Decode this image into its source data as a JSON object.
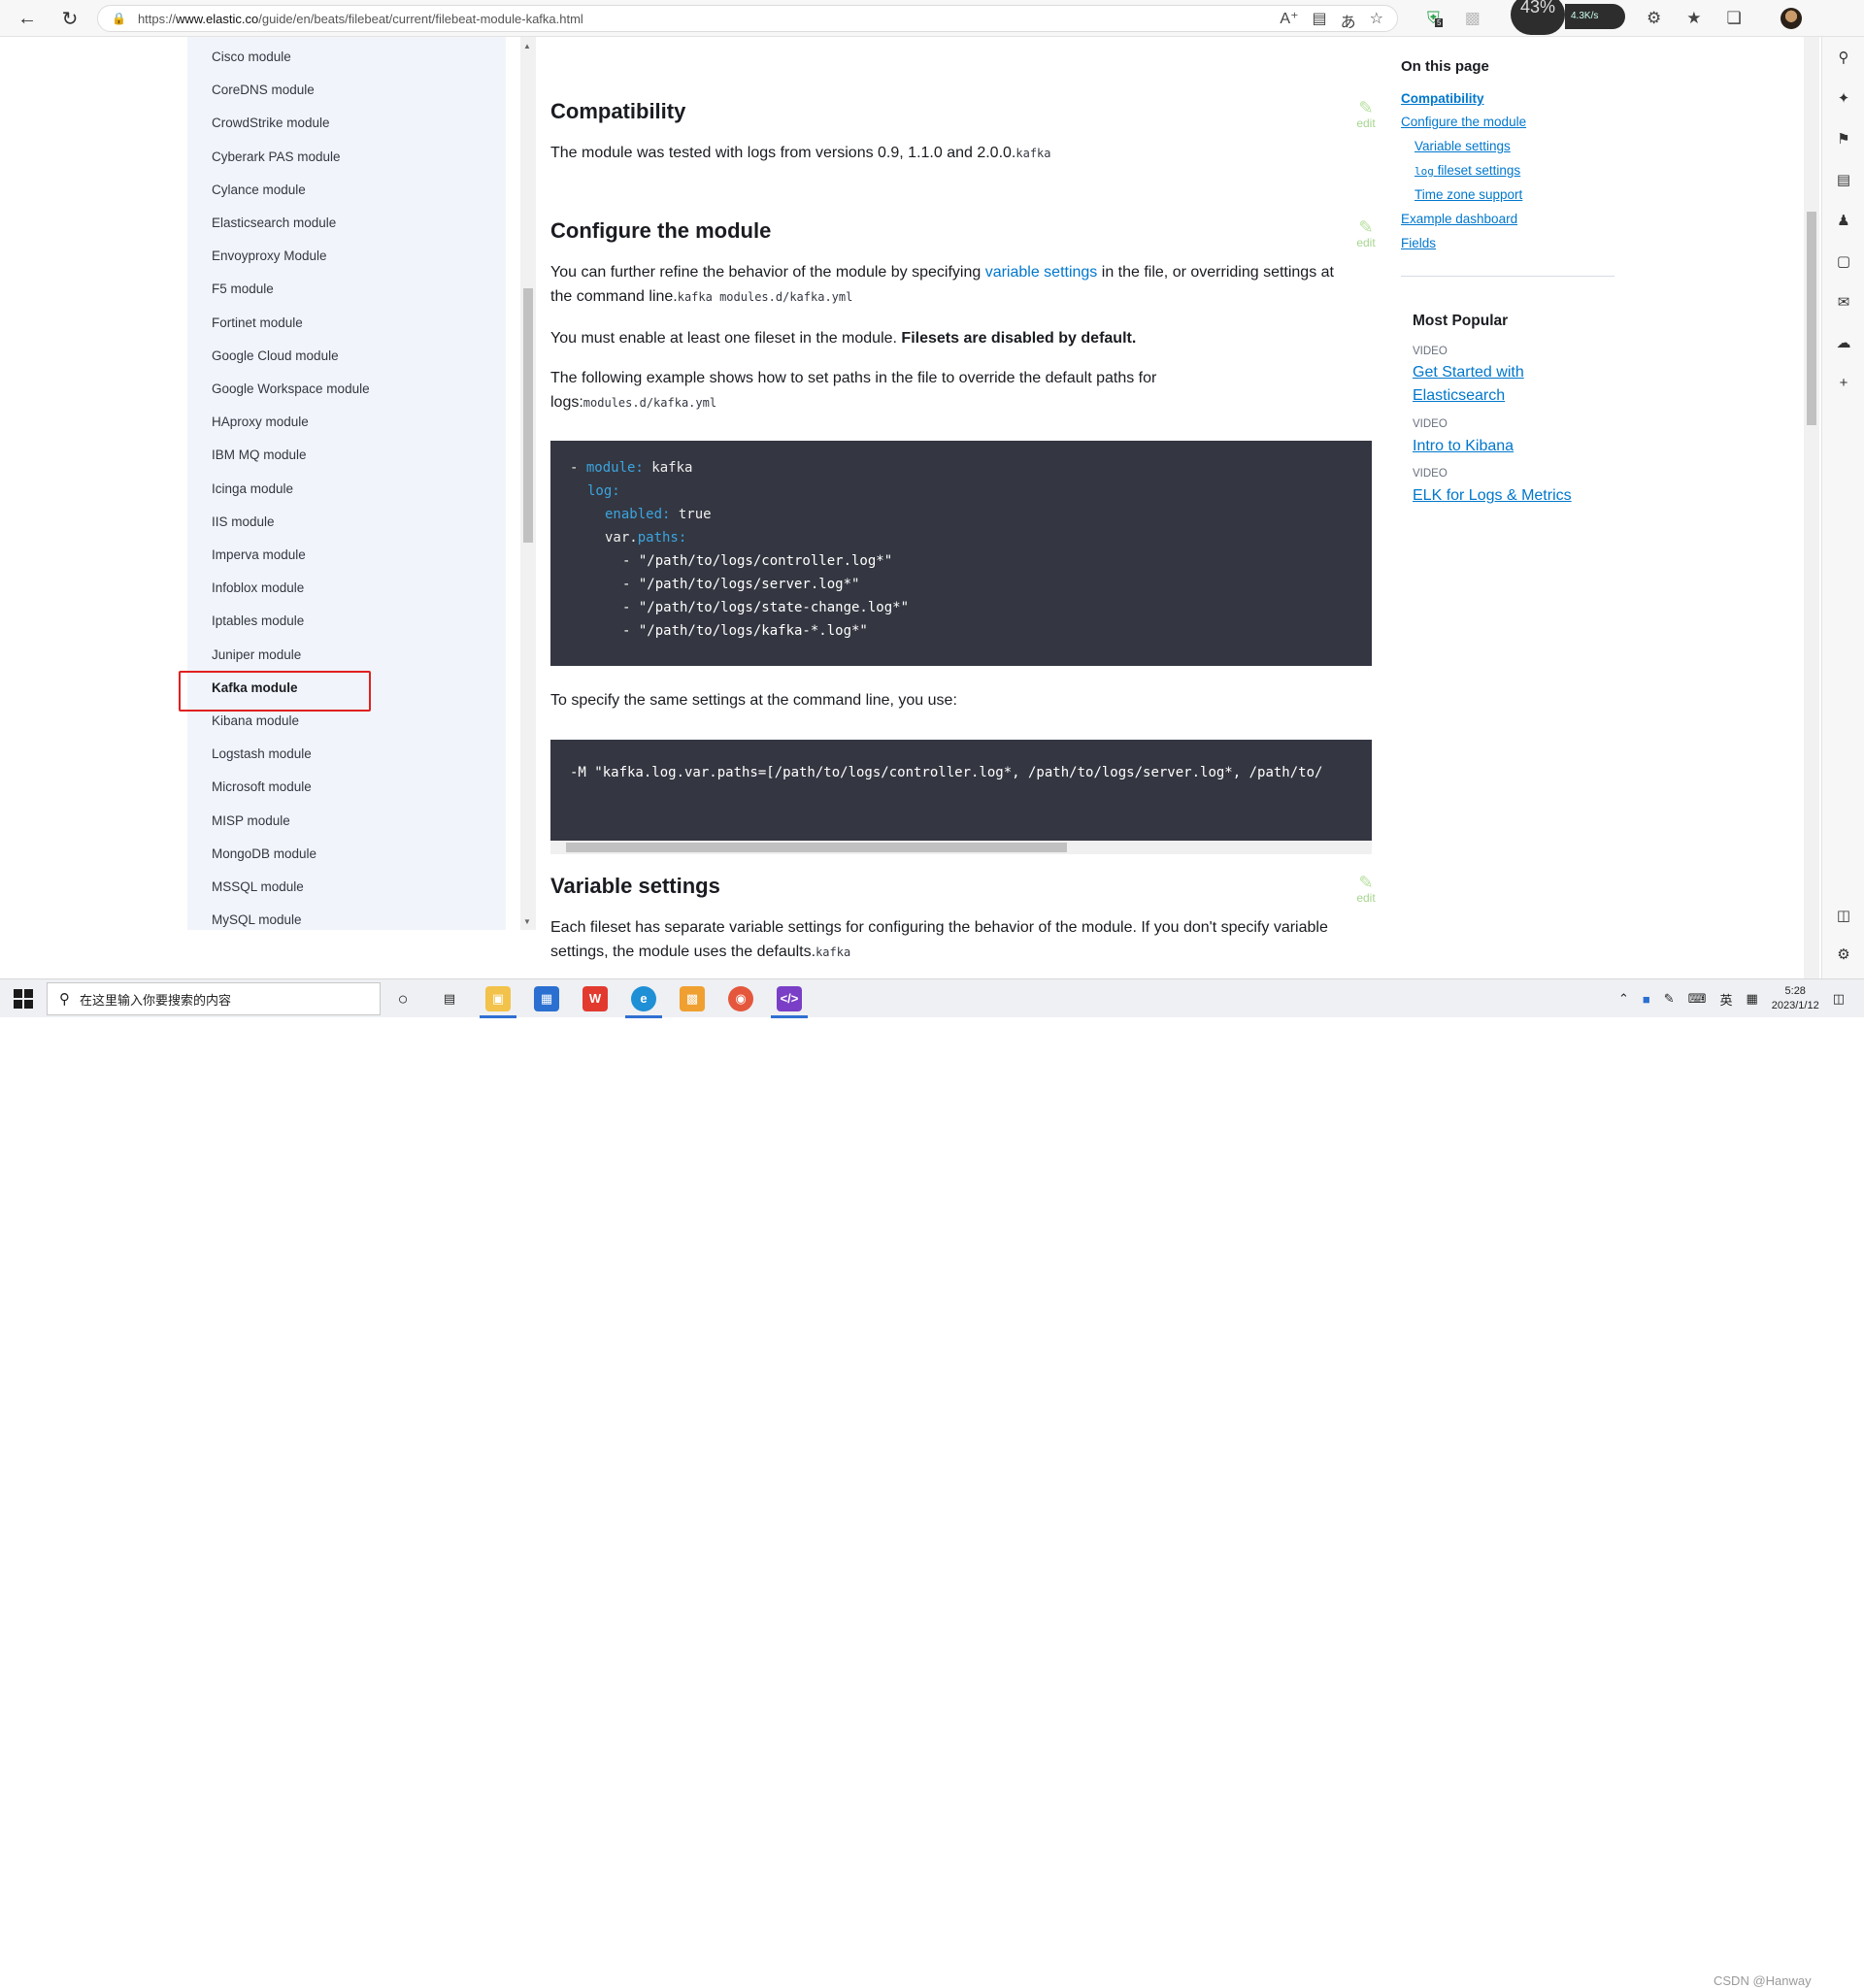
{
  "browser": {
    "url_prefix": "https://",
    "url_host": "www.elastic.co",
    "url_path": "/guide/en/beats/filebeat/current/filebeat-module-kafka.html",
    "cpu_percent": "43%",
    "net_speed": "4.3K/s",
    "ext_badge": "5"
  },
  "leftnav": {
    "items": [
      "Cisco module",
      "CoreDNS module",
      "CrowdStrike module",
      "Cyberark PAS module",
      "Cylance module",
      "Elasticsearch module",
      "Envoyproxy Module",
      "F5 module",
      "Fortinet module",
      "Google Cloud module",
      "Google Workspace module",
      "HAproxy module",
      "IBM MQ module",
      "Icinga module",
      "IIS module",
      "Imperva module",
      "Infoblox module",
      "Iptables module",
      "Juniper module",
      "Kafka module",
      "Kibana module",
      "Logstash module",
      "Microsoft module",
      "MISP module",
      "MongoDB module",
      "MSSQL module",
      "MySQL module"
    ],
    "active": "Kafka module"
  },
  "main": {
    "edit_label": "edit",
    "compat": {
      "title": "Compatibility",
      "text": "The module was tested with logs from versions 0.9, 1.1.0 and 2.0.0.",
      "code": "kafka"
    },
    "configure": {
      "title": "Configure the module",
      "p1_a": "You can further refine the behavior of the module by specifying ",
      "p1_link": "variable settings",
      "p1_b": " in the file, or overriding settings at the command line.",
      "p1_code": "kafka modules.d/kafka.yml",
      "p2_a": "You must enable at least one fileset in the module. ",
      "p2_bold": "Filesets are disabled by default.",
      "p3": "The following example shows how to set paths in the file to override the default paths for logs:",
      "p3_code": "modules.d/kafka.yml",
      "yaml": {
        "l1_dash": "- ",
        "l1_key": "module:",
        "l1_val": " kafka",
        "l2_key": "log:",
        "l3_key": "enabled:",
        "l3_val": " true",
        "l4_pre": "var.",
        "l4_key": "paths:",
        "paths": [
          "- \"/path/to/logs/controller.log*\"",
          "- \"/path/to/logs/server.log*\"",
          "- \"/path/to/logs/state-change.log*\"",
          "- \"/path/to/logs/kafka-*.log*\""
        ]
      },
      "p4": "To specify the same settings at the command line, you use:",
      "cmd": "-M \"kafka.log.var.paths=[/path/to/logs/controller.log*, /path/to/logs/server.log*, /path/to/"
    },
    "variables": {
      "title": "Variable settings",
      "text": "Each fileset has separate variable settings for configuring the behavior of the module. If you don't specify variable settings, the module uses the defaults.",
      "code": "kafka"
    }
  },
  "onpage": {
    "heading": "On this page",
    "links": [
      "Compatibility",
      "Configure the module",
      "Variable settings",
      "fileset settings",
      "Time zone support",
      "Example dashboard",
      "Fields"
    ],
    "log_code": "log"
  },
  "popular": {
    "heading": "Most Popular",
    "video_label": "VIDEO",
    "items": [
      "Get Started with Elasticsearch",
      "Intro to Kibana",
      "ELK for Logs & Metrics"
    ]
  },
  "taskbar": {
    "search_placeholder": "在这里输入你要搜索的内容",
    "ime": "英",
    "time": "5:28",
    "date": "2023/1/12",
    "watermark": "CSDN @Hanway"
  }
}
